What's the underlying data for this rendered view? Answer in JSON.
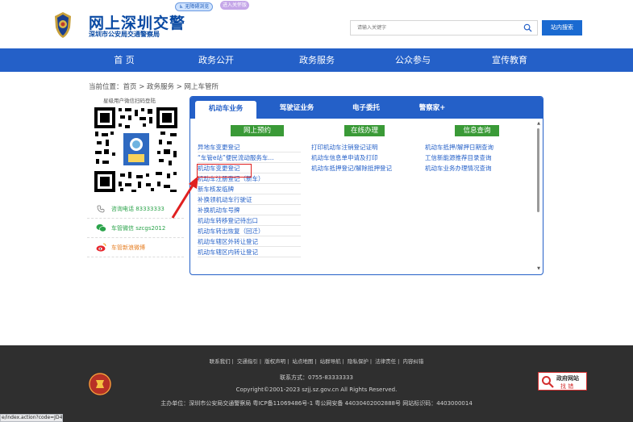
{
  "header": {
    "title": "网上深圳交警",
    "subtitle": "深圳市公安局交通警察局",
    "accessibility_label": "无障碍浏览",
    "elder_label": "进入关怀版",
    "search_placeholder": "请输入关键字",
    "search_button": "站内搜索"
  },
  "nav": {
    "items": [
      "首 页",
      "政务公开",
      "政务服务",
      "公众参与",
      "宣传教育"
    ]
  },
  "breadcrumb": "当前位置：首页 > 政务服务 > 网上车管所",
  "sidebar": {
    "qr_caption": "星级用户微信扫码登陆",
    "items": [
      {
        "icon": "phone-icon",
        "label": "咨询电话 83333333"
      },
      {
        "icon": "wechat-icon",
        "label": "车管微信 szcgs2012"
      },
      {
        "icon": "weibo-icon",
        "label": "车管新浪微博"
      }
    ]
  },
  "panel": {
    "tabs": [
      "机动车业务",
      "驾驶证业务",
      "电子委托",
      "警察家+"
    ],
    "columns": [
      {
        "header": "网上预约",
        "links": [
          "异地车变更登记",
          "“车管e站”便民流动服务车...",
          "机动车变更登记",
          "机动车注册登记（新车）",
          "新车核发临牌",
          "补换领机动车行驶证",
          "补换机动车号牌",
          "机动车转移登记待出口",
          "机动车转出恢复（回迁）",
          "机动车辖区外转让登记",
          "机动车辖区内转让登记"
        ]
      },
      {
        "header": "在线办理",
        "links": [
          "打印机动车注销登记证明",
          "机动车信息单申请及打印",
          "机动车抵押登记/解除抵押登记"
        ]
      },
      {
        "header": "信息查询",
        "links": [
          "机动车抵押/解押日期查询",
          "工信新能源推荐目录查询",
          "机动车业务办理情况查询"
        ]
      }
    ]
  },
  "footer": {
    "links": [
      "联系我们",
      "交通指引",
      "版权声明",
      "站点地图",
      "站群导航",
      "隐私保护",
      "法律责任",
      "内容纠错"
    ],
    "contact": "联系方式：0755-83333333",
    "copyright": "Copyright©2001-2023 szjj.sz.gov.cn   All Rights Reserved.",
    "host": "主办单位：深圳市公安局交通警察局  粤ICP备11069486号-1  粤公网安备 44030402002888号  网站标识码：4403000014",
    "badge_line1": "政府网站",
    "badge_line2": "找 错"
  },
  "status_url": "e/index.action?code=JD47"
}
